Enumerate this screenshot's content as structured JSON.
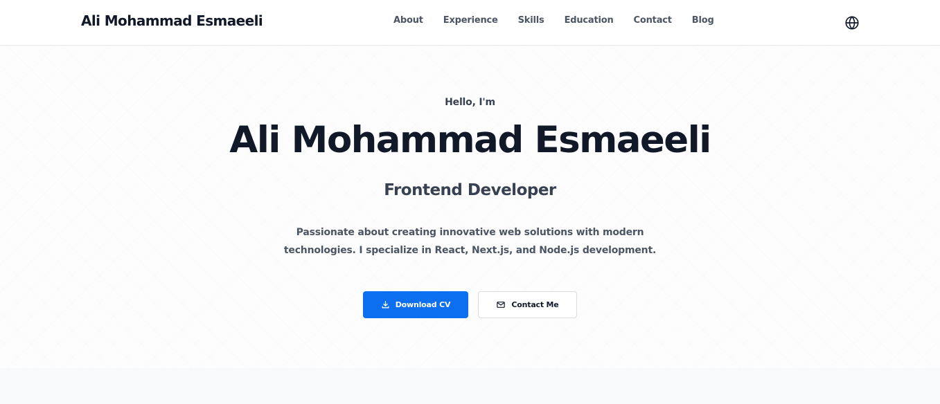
{
  "header": {
    "brand": "Ali Mohammad Esmaeeli",
    "nav": [
      {
        "label": "About"
      },
      {
        "label": "Experience"
      },
      {
        "label": "Skills"
      },
      {
        "label": "Education"
      },
      {
        "label": "Contact"
      },
      {
        "label": "Blog"
      }
    ],
    "language_icon": "globe-icon"
  },
  "hero": {
    "greeting": "Hello, I'm",
    "name": "Ali Mohammad Esmaeeli",
    "role": "Frontend Developer",
    "description": "Passionate about creating innovative web solutions with modern technologies. I specialize in React, Next.js, and Node.js development.",
    "buttons": {
      "download_cv": {
        "label": "Download CV",
        "icon": "download-icon"
      },
      "contact_me": {
        "label": "Contact Me",
        "icon": "mail-icon"
      }
    }
  },
  "colors": {
    "primary": "#0b6ff0",
    "text_dark": "#111827",
    "text_muted": "#4b5563"
  }
}
